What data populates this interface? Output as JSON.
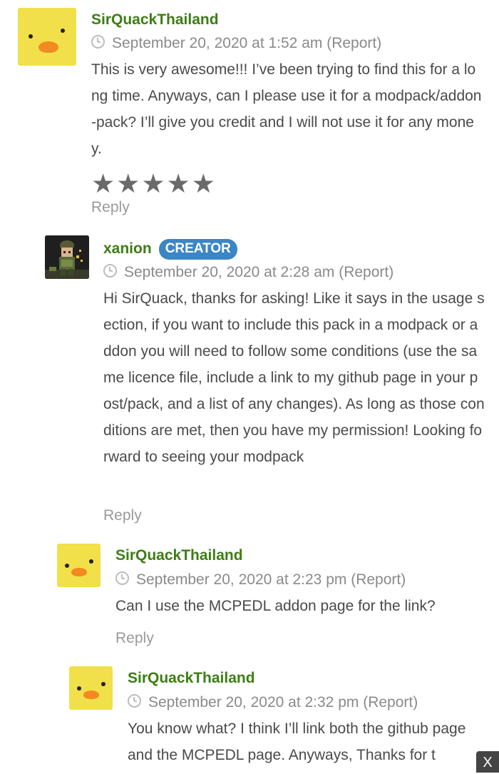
{
  "comments": [
    {
      "author": "SirQuackThailand",
      "date": "September 20, 2020 at 1:52 am (Report)",
      "text": "This is very awesome!!! I’ve been trying to find this for a long time. Anyways, can I please use it for a modpack/addon-pack? I’ll give you credit and I will not use it for any money.",
      "rating": 5,
      "reply_label": "Reply",
      "avatar_icon": "duck-avatar"
    },
    {
      "author": "xanion",
      "badge": "CREATOR",
      "date": "September 20, 2020 at 2:28 am (Report)",
      "text": "Hi SirQuack, thanks for asking! Like it says in the usage section, if you want to include this pack in a modpack or addon you will need to follow some conditions (use the same licence file, include a link to my github page in your post/pack, and a list of any changes). As long as those conditions are met, then you have my permission! Looking forward to seeing your modpack",
      "reply_label": "Reply",
      "avatar_icon": "character-avatar"
    },
    {
      "author": "SirQuackThailand",
      "date": "September 20, 2020 at 2:23 pm (Report)",
      "text": "Can I use the MCPEDL addon page for the link?",
      "reply_label": "Reply",
      "avatar_icon": "duck-avatar"
    },
    {
      "author": "SirQuackThailand",
      "date": "September 20, 2020 at 2:32 pm (Report)",
      "text": "You know what? I think I’ll link both the github page and the MCPEDL page. Anyways, Thanks for t",
      "avatar_icon": "duck-avatar"
    }
  ],
  "close_label": "X",
  "colors": {
    "author": "#3d7d14",
    "badge": "#3b86c6",
    "duck": "#f1e04a"
  }
}
